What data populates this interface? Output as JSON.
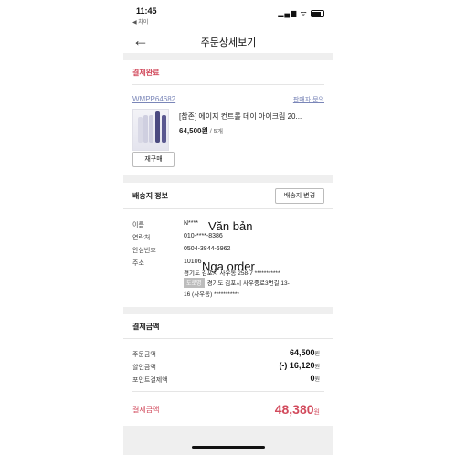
{
  "status_bar": {
    "time": "11:45",
    "back_app": "◀ 차이",
    "icons_text": "▂▄▆ ᯤ"
  },
  "header": {
    "title": "주문상세보기",
    "back_icon": "←"
  },
  "order": {
    "status": "결제완료",
    "number": "WMPP64682",
    "seller_inquiry": "판매자 문의",
    "product_name": "[참존] 에이지 컨트롤 데이 아이크림 20...",
    "price": "64,500원",
    "quantity": " / 5개",
    "rebuy_label": "재구매"
  },
  "shipping": {
    "title": "배송지 정보",
    "change_label": "배송지 변경",
    "rows": [
      {
        "label": "이름",
        "value": "N****"
      },
      {
        "label": "연락처",
        "value": "010-****-8386"
      },
      {
        "label": "안심번호",
        "value": "0504-3844-6962"
      },
      {
        "label": "주소",
        "value": "10106"
      }
    ],
    "address_line1": "경기도 김포시 사우동 258-7 ***********",
    "road_badge": "도로명",
    "address_line2": "경기도 김포시 사우중로3번길 13-",
    "address_line3": "16 (사우동) ***********"
  },
  "overlay": {
    "text1": "Văn bản",
    "text2": "Nga order"
  },
  "payment": {
    "title": "결제금액",
    "rows": [
      {
        "label": "주문금액",
        "value": "64,500",
        "unit": "원"
      },
      {
        "label": "할인금액",
        "value": "(-) 16,120",
        "unit": "원"
      },
      {
        "label": "포인트결제액",
        "value": "0",
        "unit": "원"
      }
    ],
    "total_label": "결제금액",
    "total_value": "48,380",
    "total_unit": "원"
  },
  "colors": {
    "accent_red": "#d24a5c",
    "link_blue": "#7a86b8"
  }
}
